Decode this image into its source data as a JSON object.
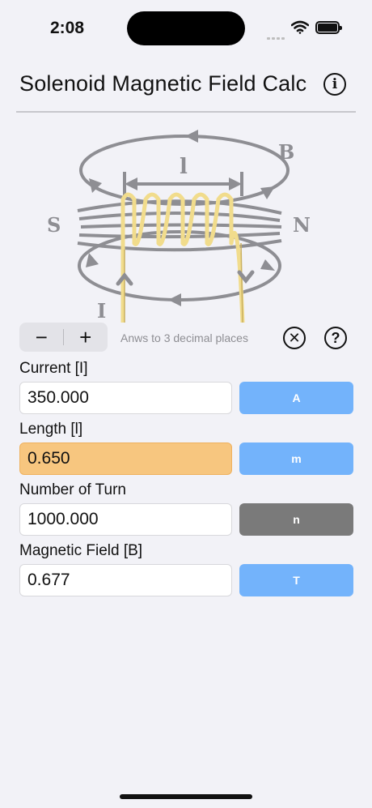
{
  "status": {
    "time": "2:08"
  },
  "header": {
    "title": "Solenoid Magnetic Field Calc",
    "info_icon": "info-circle-icon"
  },
  "diagram": {
    "labels": {
      "length": "l",
      "field": "B",
      "south": "S",
      "north": "N",
      "current": "I"
    },
    "colors": {
      "coil": "#f1dc8c",
      "lines": "#8e8e93"
    }
  },
  "controls": {
    "decrement_label": "−",
    "increment_label": "+",
    "decimals_text": "Anws to 3 decimal places",
    "clear_icon": "clear-circle-icon",
    "help_icon": "help-circle-icon"
  },
  "fields": [
    {
      "label": "Current [I]",
      "value": "350.000",
      "unit": "A"
    },
    {
      "label": "Length [l]",
      "value": "0.650",
      "unit": "m"
    },
    {
      "label": "Number of Turn",
      "value": "1000.000",
      "unit": "n"
    },
    {
      "label": "Magnetic Field [B]",
      "value": "0.677",
      "unit": "T"
    }
  ],
  "colors": {
    "unit_button": "#73b3fb",
    "unit_button_selected": "#7a7a7a",
    "active_field": "#f7c67f"
  }
}
